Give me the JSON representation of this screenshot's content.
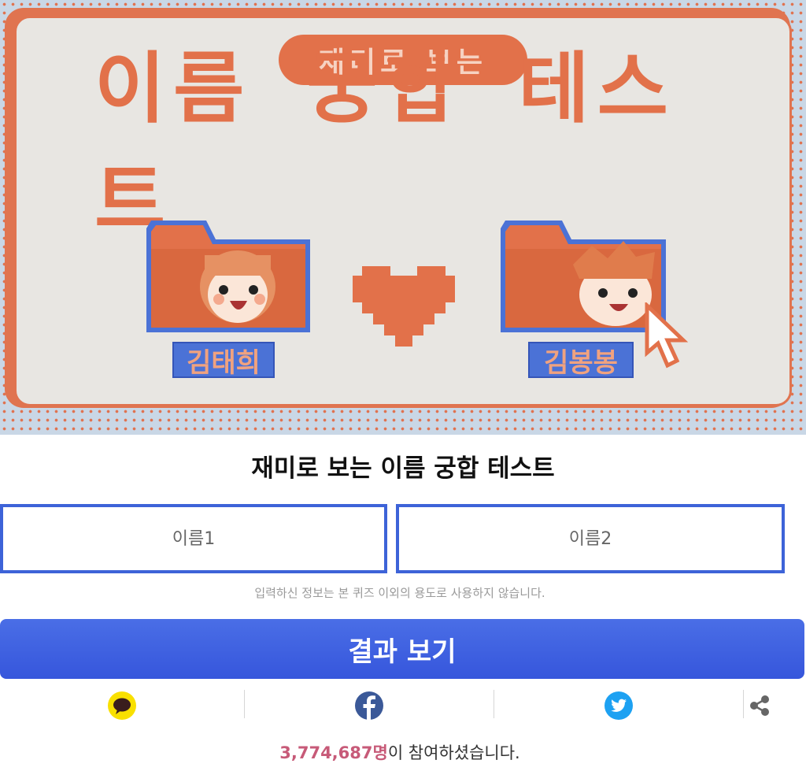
{
  "banner": {
    "badge_text": "재미로 보는",
    "headline": "이름 궁합 테스트",
    "example_name_1": "김태희",
    "example_name_2": "김봉봉",
    "heart_icon": "pixel-heart-icon",
    "colors": {
      "accent": "#e2714a",
      "card_bg": "#e8e6e2",
      "tag_blue": "#4b72d6"
    }
  },
  "page": {
    "title": "재미로 보는 이름 궁합 테스트"
  },
  "form": {
    "name1_placeholder": "이름1",
    "name1_value": "",
    "name2_placeholder": "이름2",
    "name2_value": "",
    "privacy_notice": "입력하신 정보는 본 퀴즈 이외의 용도로 사용하지 않습니다.",
    "submit_label": "결과 보기",
    "submit_color": "#3d63d8"
  },
  "share": {
    "items": [
      {
        "icon": "kakaotalk-icon",
        "color": "#f9e000"
      },
      {
        "icon": "facebook-icon",
        "color": "#3b5998"
      },
      {
        "icon": "twitter-icon",
        "color": "#1da1f2"
      },
      {
        "icon": "share-icon",
        "color": "#666666"
      }
    ]
  },
  "stats": {
    "participant_count": "3,774,687명",
    "participant_suffix": "이 참여하셨습니다.",
    "count_color": "#c75a78"
  }
}
